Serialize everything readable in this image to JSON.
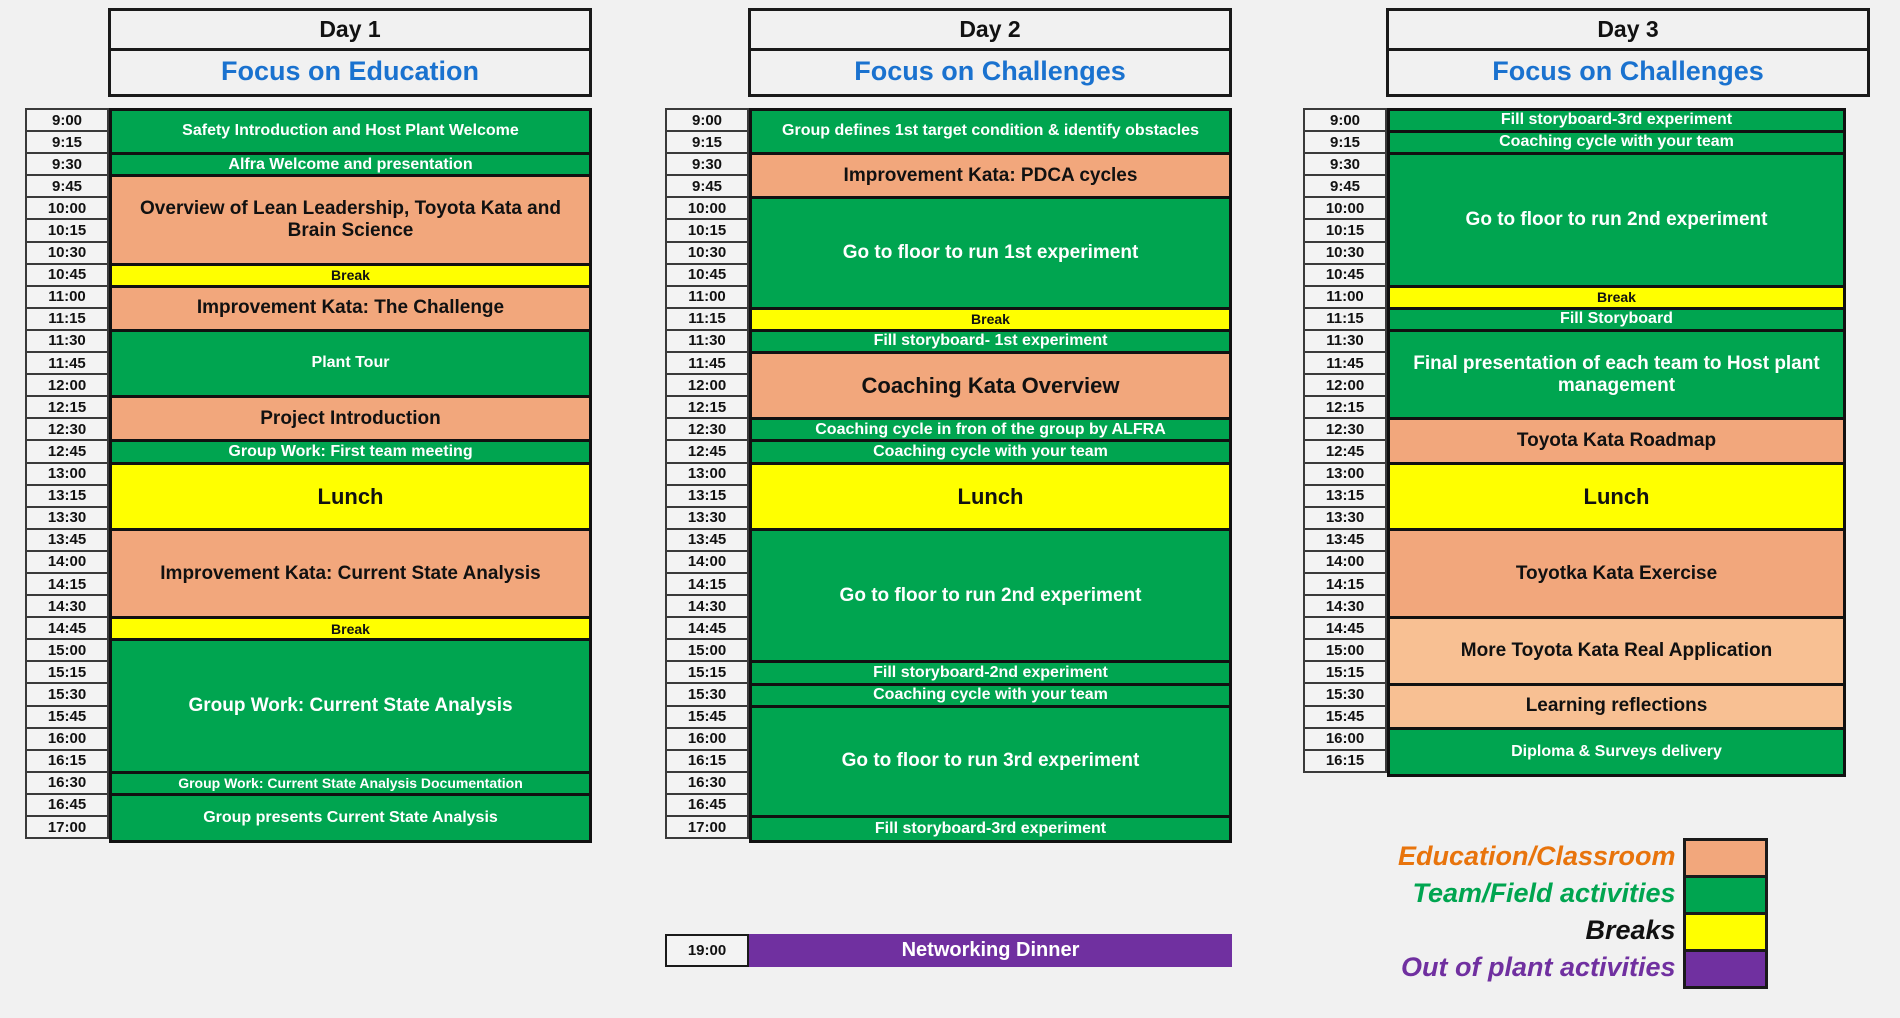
{
  "colors": {
    "education": "#F2A77C",
    "education_light": "#F8C093",
    "team": "#00A550",
    "break": "#FFFF00",
    "outofplant": "#7030A0",
    "focus_text": "#1a72cf",
    "page_bg": "#f1f1f1",
    "legend_education_text": "#E8740C",
    "legend_team_text": "#00A550",
    "legend_breaks_text": "#111111",
    "legend_outofplant_text": "#7030A0"
  },
  "days": [
    {
      "title": "Day 1",
      "focus": "Focus on Education",
      "times": [
        "9:00",
        "9:15",
        "9:30",
        "9:45",
        "10:00",
        "10:15",
        "10:30",
        "10:45",
        "11:00",
        "11:15",
        "11:30",
        "11:45",
        "12:00",
        "12:15",
        "12:30",
        "12:45",
        "13:00",
        "13:15",
        "13:30",
        "13:45",
        "14:00",
        "14:15",
        "14:30",
        "14:45",
        "15:00",
        "15:15",
        "15:30",
        "15:45",
        "16:00",
        "16:15",
        "16:30",
        "16:45",
        "17:00"
      ],
      "blocks": [
        {
          "label": "Safety Introduction and Host Plant Welcome",
          "slots": 2,
          "type": "team",
          "size": "md"
        },
        {
          "label": "Alfra Welcome and presentation",
          "slots": 1,
          "type": "team",
          "size": "md"
        },
        {
          "label": "Overview of Lean Leadership, Toyota Kata and Brain Science",
          "slots": 4,
          "type": "education",
          "size": "lg"
        },
        {
          "label": "Break",
          "slots": 1,
          "type": "break",
          "size": "sm"
        },
        {
          "label": "Improvement Kata: The Challenge",
          "slots": 2,
          "type": "education",
          "size": "lg"
        },
        {
          "label": "Plant Tour",
          "slots": 3,
          "type": "team",
          "size": "md"
        },
        {
          "label": "Project Introduction",
          "slots": 2,
          "type": "education",
          "size": "lg"
        },
        {
          "label": "Group Work: First team meeting",
          "slots": 1,
          "type": "team",
          "size": "md"
        },
        {
          "label": "Lunch",
          "slots": 3,
          "type": "break",
          "size": "xl"
        },
        {
          "label": "Improvement Kata: Current State Analysis",
          "slots": 4,
          "type": "education",
          "size": "lg"
        },
        {
          "label": "Break",
          "slots": 1,
          "type": "break",
          "size": "sm"
        },
        {
          "label": "Group Work: Current State Analysis",
          "slots": 6,
          "type": "team",
          "size": "lg"
        },
        {
          "label": "Group Work: Current State Analysis Documentation",
          "slots": 1,
          "type": "team",
          "size": "sm"
        },
        {
          "label": "Group presents Current State Analysis",
          "slots": 2,
          "type": "team",
          "size": "md"
        }
      ]
    },
    {
      "title": "Day 2",
      "focus": "Focus on Challenges",
      "times": [
        "9:00",
        "9:15",
        "9:30",
        "9:45",
        "10:00",
        "10:15",
        "10:30",
        "10:45",
        "11:00",
        "11:15",
        "11:30",
        "11:45",
        "12:00",
        "12:15",
        "12:30",
        "12:45",
        "13:00",
        "13:15",
        "13:30",
        "13:45",
        "14:00",
        "14:15",
        "14:30",
        "14:45",
        "15:00",
        "15:15",
        "15:30",
        "15:45",
        "16:00",
        "16:15",
        "16:30",
        "16:45",
        "17:00"
      ],
      "blocks": [
        {
          "label": "Group defines 1st target condition & identify obstacles",
          "slots": 2,
          "type": "team",
          "size": "md"
        },
        {
          "label": "Improvement Kata: PDCA cycles",
          "slots": 2,
          "type": "education",
          "size": "lg"
        },
        {
          "label": "Go to floor to run 1st experiment",
          "slots": 5,
          "type": "team",
          "size": "lg"
        },
        {
          "label": "Break",
          "slots": 1,
          "type": "break",
          "size": "sm"
        },
        {
          "label": "Fill storyboard- 1st experiment",
          "slots": 1,
          "type": "team",
          "size": "md"
        },
        {
          "label": "Coaching Kata Overview",
          "slots": 3,
          "type": "education",
          "size": "xl"
        },
        {
          "label": "Coaching cycle in fron of the group by ALFRA",
          "slots": 1,
          "type": "team",
          "size": "md"
        },
        {
          "label": "Coaching cycle with your team",
          "slots": 1,
          "type": "team",
          "size": "md"
        },
        {
          "label": "Lunch",
          "slots": 3,
          "type": "break",
          "size": "xl"
        },
        {
          "label": "Go to floor to run 2nd experiment",
          "slots": 6,
          "type": "team",
          "size": "lg"
        },
        {
          "label": "Fill storyboard-2nd experiment",
          "slots": 1,
          "type": "team",
          "size": "md"
        },
        {
          "label": "Coaching cycle with your team",
          "slots": 1,
          "type": "team",
          "size": "md"
        },
        {
          "label": "Go to floor to run 3rd experiment",
          "slots": 5,
          "type": "team",
          "size": "lg"
        },
        {
          "label": "Fill storyboard-3rd experiment",
          "slots": 1,
          "type": "team",
          "size": "md"
        }
      ],
      "dinner": {
        "time": "19:00",
        "label": "Networking Dinner",
        "type": "outofplant"
      }
    },
    {
      "title": "Day 3",
      "focus": "Focus on Challenges",
      "times": [
        "9:00",
        "9:15",
        "9:30",
        "9:45",
        "10:00",
        "10:15",
        "10:30",
        "10:45",
        "11:00",
        "11:15",
        "11:30",
        "11:45",
        "12:00",
        "12:15",
        "12:30",
        "12:45",
        "13:00",
        "13:15",
        "13:30",
        "13:45",
        "14:00",
        "14:15",
        "14:30",
        "14:45",
        "15:00",
        "15:15",
        "15:30",
        "15:45",
        "16:00",
        "16:15"
      ],
      "blocks": [
        {
          "label": "Fill storyboard-3rd experiment",
          "slots": 1,
          "type": "team",
          "size": "md"
        },
        {
          "label": "Coaching cycle with your team",
          "slots": 1,
          "type": "team",
          "size": "md"
        },
        {
          "label": "Go to floor to run 2nd experiment",
          "slots": 6,
          "type": "team",
          "size": "lg"
        },
        {
          "label": "Break",
          "slots": 1,
          "type": "break",
          "size": "sm"
        },
        {
          "label": "Fill Storyboard",
          "slots": 1,
          "type": "team",
          "size": "md"
        },
        {
          "label": "Final presentation of each team to Host plant management",
          "slots": 4,
          "type": "team",
          "size": "lg"
        },
        {
          "label": "Toyota Kata Roadmap",
          "slots": 2,
          "type": "education",
          "size": "lg"
        },
        {
          "label": "Lunch",
          "slots": 3,
          "type": "break",
          "size": "xl"
        },
        {
          "label": "Toyotka Kata Exercise",
          "slots": 4,
          "type": "education",
          "size": "lg"
        },
        {
          "label": "More Toyota Kata Real Application",
          "slots": 3,
          "type": "education_light",
          "size": "lg"
        },
        {
          "label": "Learning reflections",
          "slots": 2,
          "type": "education_light",
          "size": "lg"
        },
        {
          "label": "Diploma & Surveys delivery",
          "slots": 2,
          "type": "team",
          "size": "md"
        }
      ]
    }
  ],
  "legend": {
    "items": [
      {
        "label": "Education/Classroom",
        "type": "education"
      },
      {
        "label": "Team/Field activities",
        "type": "team"
      },
      {
        "label": "Breaks",
        "type": "break"
      },
      {
        "label": "Out of plant activities",
        "type": "outofplant"
      }
    ]
  }
}
